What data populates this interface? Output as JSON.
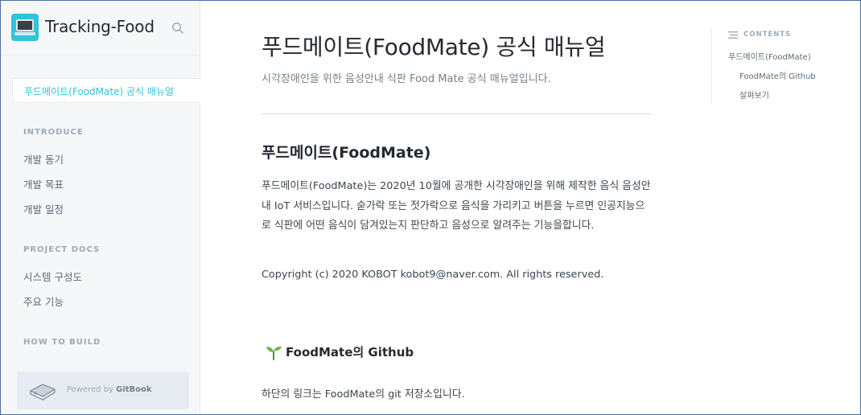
{
  "sidebar": {
    "brand_title": "Tracking-Food",
    "active_item": "푸드메이트(FoodMate) 공식 매뉴얼",
    "sections": [
      {
        "label": "INTRODUCE",
        "items": [
          "개발 동기",
          "개발 목표",
          "개발 일정"
        ]
      },
      {
        "label": "PROJECT DOCS",
        "items": [
          "시스템 구성도",
          "주요 기능"
        ]
      },
      {
        "label": "HOW TO BUILD",
        "items": []
      }
    ],
    "powered_prefix": "Powered by ",
    "powered_brand": "GitBook",
    "icons": {
      "logo": "laptop-icon",
      "search": "search-icon",
      "gitbook": "gitbook-icon"
    }
  },
  "main": {
    "title": "푸드메이트(FoodMate) 공식 매뉴얼",
    "subtitle": "시각장애인을 위한 음성안내 식판 Food Mate 공식 매뉴얼입니다.",
    "h2": "푸드메이트(FoodMate)",
    "paragraph": "푸드메이트(FoodMate)는 2020년 10월에 공개한 시각장애인을 위해 제작한 음식 음성안내 IoT 서비스입니다. 숟가락 또는 젓가락으로 음식을 가리키고 버튼을 누르면 인공지능으로 식판에  어떤 음식이 담겨있는지 판단하고 음성으로 알려주는 기능을합니다.",
    "copyright": "Copyright (c) 2020 KOBOT kobot9@naver.com. All rights reserved.",
    "h3": "FoodMate의 Github",
    "h3_icon": "seedling-icon",
    "paragraph2": "하단의 링크는 FoodMate의 git 저장소입니다."
  },
  "toc": {
    "heading": "CONTENTS",
    "items": [
      {
        "label": "푸드메이트(FoodMate)",
        "level": 1
      },
      {
        "label": "FoodMate의 Github",
        "level": 2
      },
      {
        "label": "살펴보기",
        "level": 2
      }
    ]
  },
  "colors": {
    "accent": "#2ec4d9",
    "sidebar_bg": "#f5f7f9",
    "text": "#242a31",
    "muted": "#9daab6"
  }
}
